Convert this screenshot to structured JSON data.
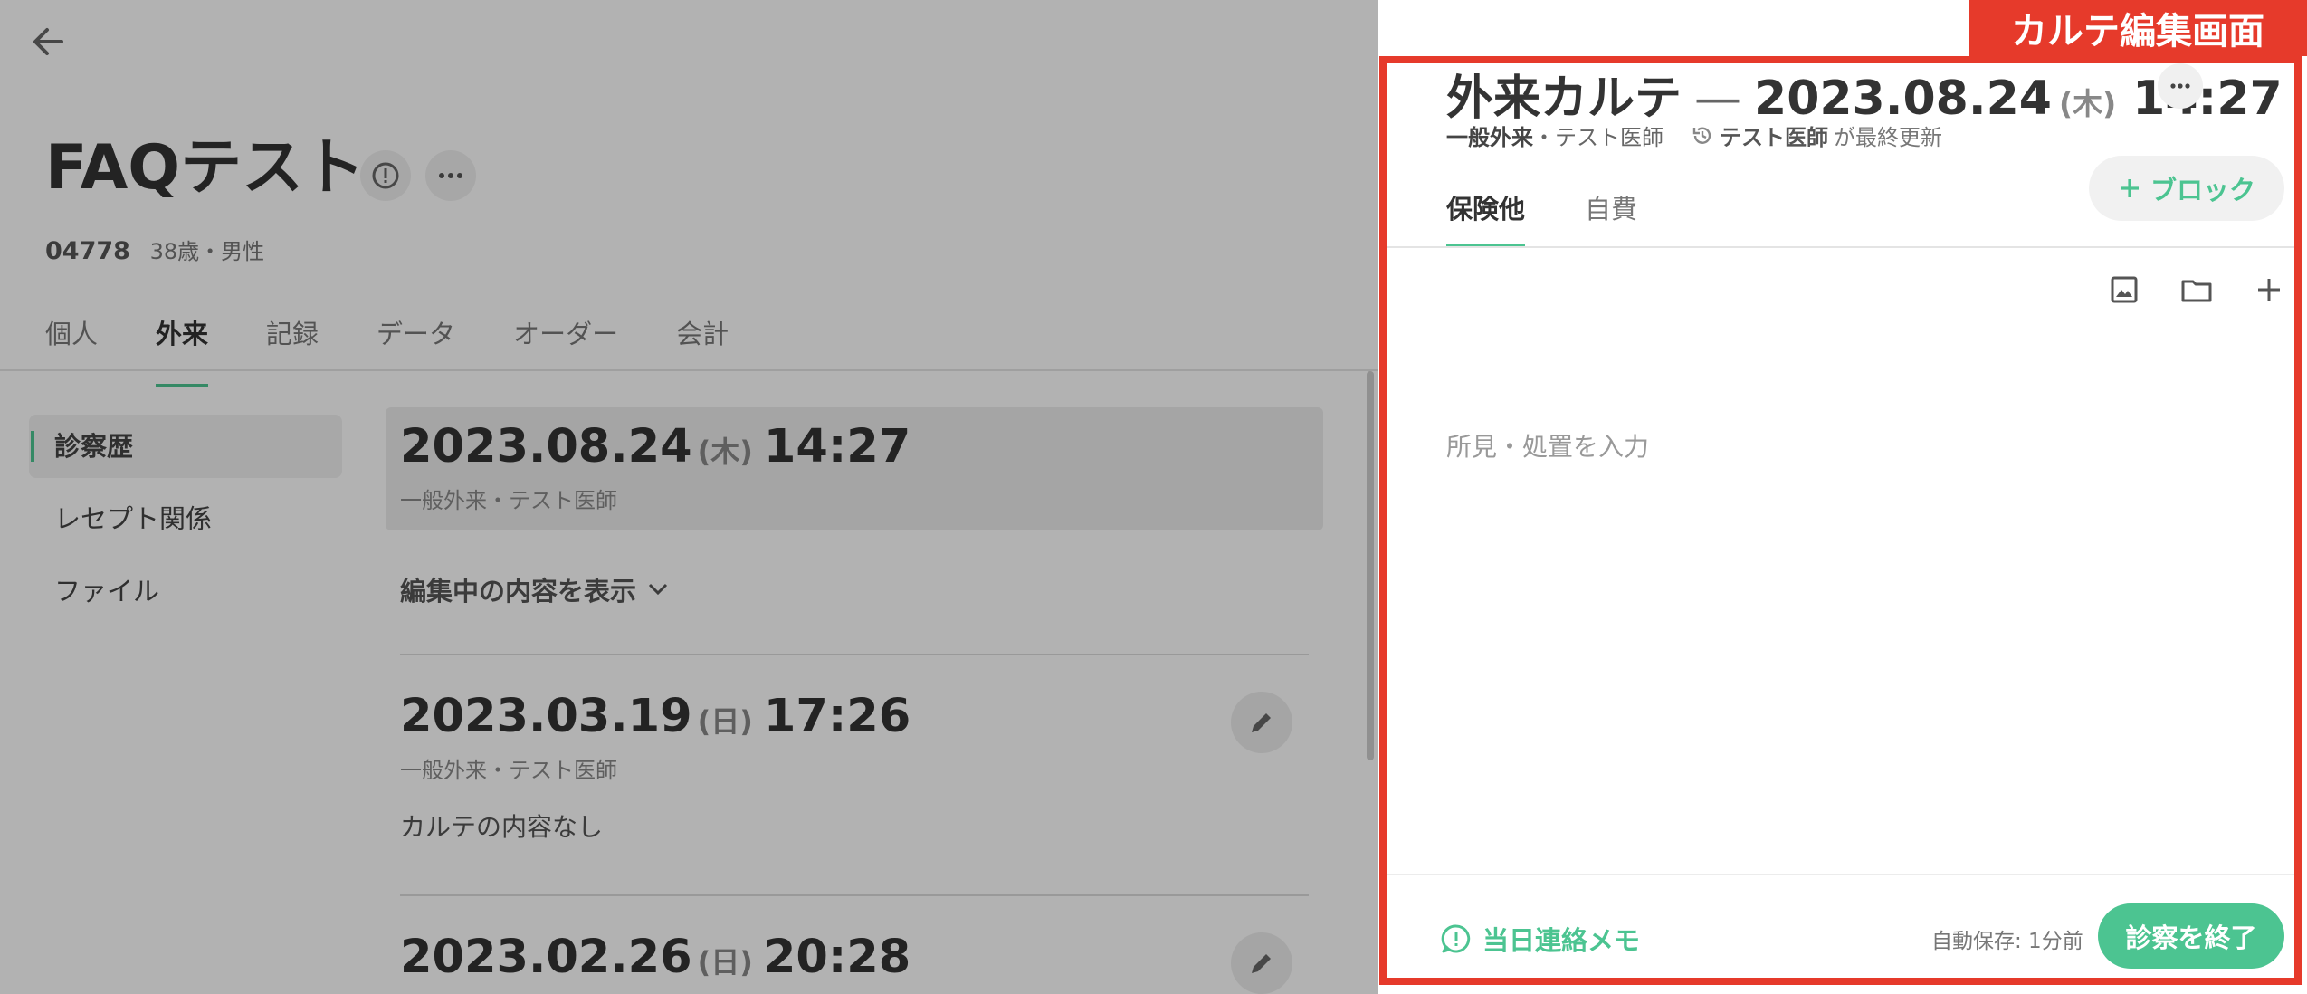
{
  "left": {
    "patient": {
      "name": "FAQテスト",
      "id": "04778",
      "age_sex": "38歳・男性"
    },
    "tabs": [
      {
        "label": "個人"
      },
      {
        "label": "外来",
        "active": true
      },
      {
        "label": "記録"
      },
      {
        "label": "データ"
      },
      {
        "label": "オーダー"
      },
      {
        "label": "会計"
      }
    ],
    "side_nav": [
      {
        "label": "診察歴",
        "active": true
      },
      {
        "label": "レセプト関係"
      },
      {
        "label": "ファイル"
      }
    ],
    "visits": [
      {
        "date": "2023.08.24",
        "dow": "(木)",
        "time": "14:27",
        "sub": "一般外来・テスト医師",
        "body": ""
      },
      {
        "date": "2023.03.19",
        "dow": "(日)",
        "time": "17:26",
        "sub": "一般外来・テスト医師",
        "body": "カルテの内容なし"
      },
      {
        "date": "2023.02.26",
        "dow": "(日)",
        "time": "20:28",
        "sub": "",
        "body": ""
      }
    ],
    "show_editing_label": "編集中の内容を表示"
  },
  "annotation": {
    "label": "カルテ編集画面",
    "color": "#e63a2b"
  },
  "karte": {
    "title": "外来カルテ",
    "dash": "—",
    "date": "2023.08.24",
    "dow": "(木)",
    "time": "14:27",
    "department": "一般外来",
    "doctor": "・テスト医師",
    "updated_by": "テスト医師",
    "updated_suffix": "が最終更新",
    "tabs": [
      {
        "label": "保険他",
        "active": true
      },
      {
        "label": "自費"
      }
    ],
    "block_button": "ブロック",
    "tools": [
      "image-icon",
      "folder-icon",
      "plus-icon"
    ],
    "placeholder": "所見・処置を入力",
    "memo_button": "当日連絡メモ",
    "autosave": "自動保存: 1分前",
    "finish_button": "診察を終了",
    "accent": "#4cc491"
  }
}
